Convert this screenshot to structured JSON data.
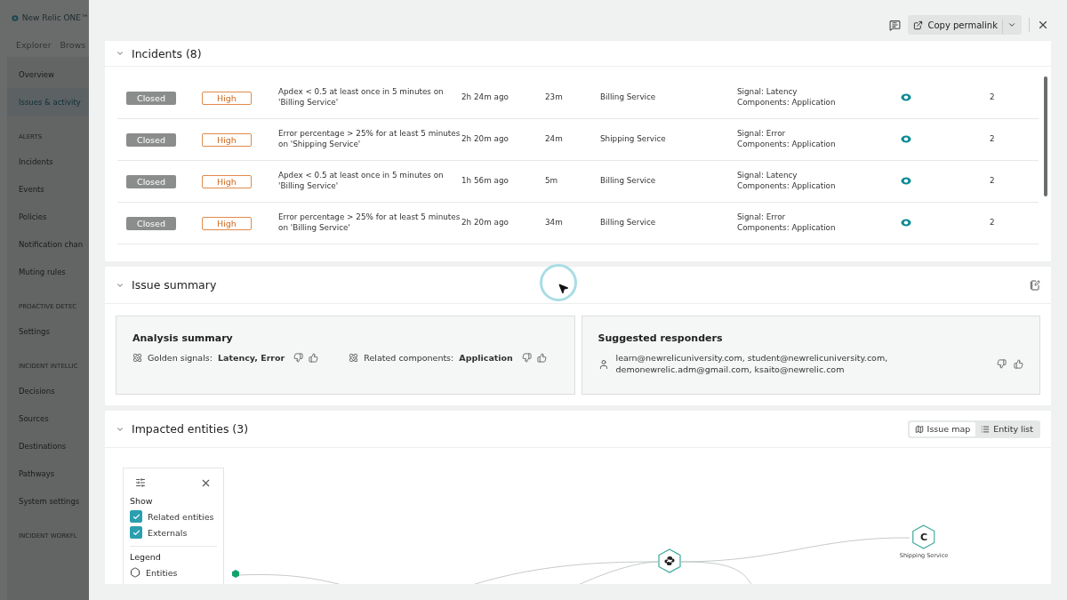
{
  "app": {
    "logo": "New Relic ONE™",
    "nav_tabs": [
      "Explorer",
      "Brows"
    ]
  },
  "sidebar": {
    "items": [
      {
        "kind": "item",
        "label": "Overview",
        "selected": false
      },
      {
        "kind": "item",
        "label": "Issues & activity",
        "selected": true
      },
      {
        "kind": "heading",
        "label": "ALERTS"
      },
      {
        "kind": "item",
        "label": "Incidents",
        "selected": false
      },
      {
        "kind": "item",
        "label": "Events",
        "selected": false
      },
      {
        "kind": "item",
        "label": "Policies",
        "selected": false
      },
      {
        "kind": "item",
        "label": "Notification chan",
        "selected": false
      },
      {
        "kind": "item",
        "label": "Muting rules",
        "selected": false
      },
      {
        "kind": "heading",
        "label": "PROACTIVE DETEC"
      },
      {
        "kind": "item",
        "label": "Settings",
        "selected": false
      },
      {
        "kind": "heading",
        "label": "INCIDENT INTELLIC"
      },
      {
        "kind": "item",
        "label": "Decisions",
        "selected": false
      },
      {
        "kind": "item",
        "label": "Sources",
        "selected": false
      },
      {
        "kind": "item",
        "label": "Destinations",
        "selected": false
      },
      {
        "kind": "item",
        "label": "Pathways",
        "selected": false
      },
      {
        "kind": "item",
        "label": "System settings",
        "selected": false
      },
      {
        "kind": "heading",
        "label": "INCIDENT WORKFL"
      }
    ]
  },
  "panel": {
    "header": {
      "copy_button": "Copy permalink"
    },
    "incidents": {
      "title": "Incidents (8)",
      "expanded": true,
      "rows": [
        {
          "state": "Closed",
          "priority": "High",
          "title": "Apdex < 0.5 at least once in 5 minutes on 'Billing Service'",
          "opened": "2h 24m ago",
          "duration": "23m",
          "entity": "Billing Service",
          "signal": "Signal: Latency",
          "components": "Components: Application",
          "count": "2"
        },
        {
          "state": "Closed",
          "priority": "High",
          "title": "Error percentage > 25% for at least 5 minutes on 'Shipping Service'",
          "opened": "2h 20m ago",
          "duration": "24m",
          "entity": "Shipping Service",
          "signal": "Signal: Error",
          "components": "Components: Application",
          "count": "2"
        },
        {
          "state": "Closed",
          "priority": "High",
          "title": "Apdex < 0.5 at least once in 5 minutes on 'Billing Service'",
          "opened": "1h 56m ago",
          "duration": "5m",
          "entity": "Billing Service",
          "signal": "Signal: Latency",
          "components": "Components: Application",
          "count": "2"
        },
        {
          "state": "Closed",
          "priority": "High",
          "title": "Error percentage > 25% for at least 5 minutes on 'Billing Service'",
          "opened": "2h 20m ago",
          "duration": "34m",
          "entity": "Billing Service",
          "signal": "Signal: Error",
          "components": "Components: Application",
          "count": "2"
        }
      ]
    },
    "issue_summary": {
      "title": "Issue summary",
      "expanded": true,
      "analysis": {
        "title": "Analysis summary",
        "items": [
          {
            "label": "Golden signals:",
            "value": "Latency, Error"
          },
          {
            "label": "Related components:",
            "value": "Application"
          }
        ]
      },
      "responders": {
        "title": "Suggested responders",
        "text": "learn@newrelicuniversity.com, student@newrelicuniversity.com, demonewrelic.adm@gmail.com, ksaito@newrelic.com"
      }
    },
    "impacted": {
      "title": "Impacted entities (3)",
      "expanded": true,
      "views": [
        {
          "label": "Issue map",
          "selected": true
        },
        {
          "label": "Entity list",
          "selected": false
        }
      ],
      "filter": {
        "show_title": "Show",
        "options": [
          {
            "label": "Related entities",
            "checked": true
          },
          {
            "label": "Externals",
            "checked": true
          }
        ],
        "legend_title": "Legend",
        "legend": [
          "Entities"
        ]
      },
      "nodes": [
        {
          "kind": "python"
        },
        {
          "kind": "letter",
          "glyph": "C",
          "label": "Shipping Service"
        }
      ]
    }
  }
}
